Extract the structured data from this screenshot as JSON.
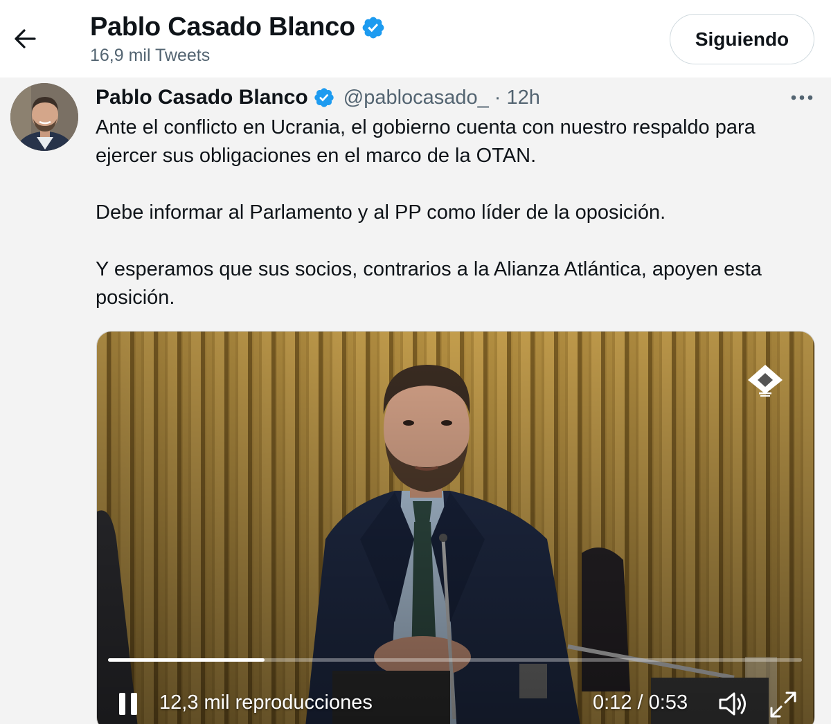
{
  "header": {
    "name": "Pablo Casado Blanco",
    "tweet_count": "16,9 mil Tweets",
    "follow_button": "Siguiendo"
  },
  "tweet": {
    "author_name": "Pablo Casado Blanco",
    "handle": "@pablocasado_",
    "separator": "·",
    "time": "12h",
    "paragraphs": [
      "Ante el conflicto en Ucrania, el gobierno cuenta con nuestro respaldo para ejercer sus obligaciones en el marco de la OTAN.",
      "Debe informar al Parlamento y al PP como líder de la oposición.",
      "Y esperamos que sus socios, contrarios a la Alianza Atlántica, apoyen esta posición."
    ]
  },
  "video": {
    "views": "12,3 mil reproducciones",
    "current_time": "0:12",
    "time_separator": " / ",
    "duration": "0:53",
    "progress_fraction": 0.226
  },
  "icons": {
    "back": "back-arrow-icon",
    "verified": "verified-badge-icon",
    "more": "more-options-icon",
    "pause": "pause-icon",
    "volume": "volume-icon",
    "fullscreen": "fullscreen-icon",
    "broadcaster": "congress-logo-icon"
  },
  "colors": {
    "verified_blue": "#1d9bf0",
    "secondary_text": "#536471",
    "primary_text": "#0f1419"
  }
}
